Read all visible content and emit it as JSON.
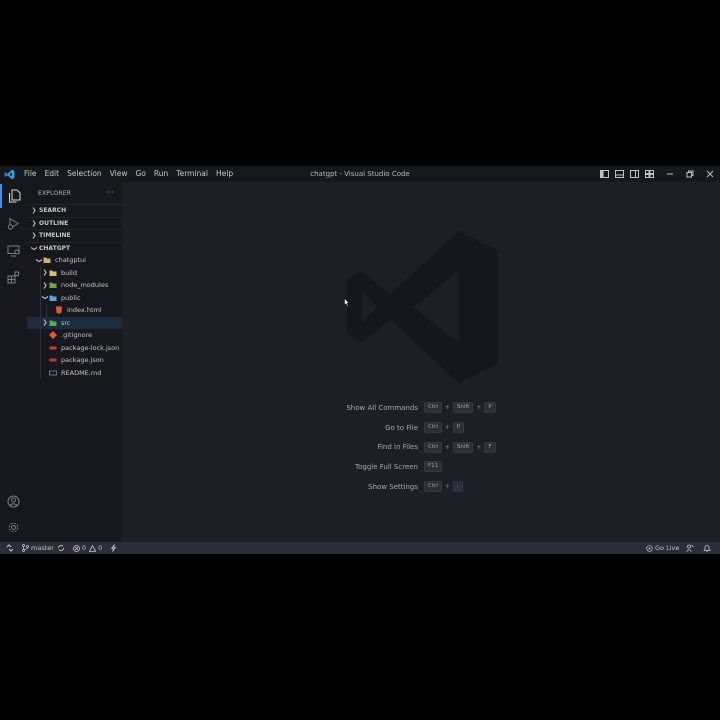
{
  "window": {
    "title": "chatgpt - Visual Studio Code",
    "accent": "#3794ff"
  },
  "menu": [
    "File",
    "Edit",
    "Selection",
    "View",
    "Go",
    "Run",
    "Terminal",
    "Help"
  ],
  "layout_controls": [
    "toggle-primary-sidebar-icon",
    "toggle-panel-icon",
    "toggle-secondary-sidebar-icon",
    "customize-layout-icon"
  ],
  "window_controls": [
    "minimize-icon",
    "restore-icon",
    "close-icon"
  ],
  "activity_bar": {
    "top": [
      "explorer-icon",
      "run-debug-icon",
      "remote-explorer-icon",
      "extensions-icon"
    ],
    "bottom": [
      "account-icon",
      "manage-gear-icon"
    ]
  },
  "sidebar": {
    "title": "EXPLORER",
    "more": "···",
    "sections": [
      "SEARCH",
      "OUTLINE",
      "TIMELINE"
    ],
    "workspace": "CHATGPT",
    "tree": [
      {
        "label": "chatgptui",
        "type": "folder",
        "expanded": true,
        "depth": 0
      },
      {
        "label": "build",
        "type": "folder",
        "expanded": false,
        "depth": 1
      },
      {
        "label": "node_modules",
        "type": "folder",
        "expanded": false,
        "depth": 1
      },
      {
        "label": "public",
        "type": "folder",
        "expanded": true,
        "depth": 1
      },
      {
        "label": "index.html",
        "type": "html",
        "depth": 2
      },
      {
        "label": "src",
        "type": "folder",
        "expanded": false,
        "depth": 1,
        "selected": true
      },
      {
        "label": ".gitignore",
        "type": "git",
        "depth": 1
      },
      {
        "label": "package-lock.json",
        "type": "json",
        "depth": 1
      },
      {
        "label": "package.json",
        "type": "json",
        "depth": 1
      },
      {
        "label": "README.md",
        "type": "md",
        "depth": 1
      }
    ]
  },
  "shortcuts": [
    {
      "label": "Show All Commands",
      "keys": [
        "Ctrl",
        "Shift",
        "P"
      ]
    },
    {
      "label": "Go to File",
      "keys": [
        "Ctrl",
        "P"
      ]
    },
    {
      "label": "Find in Files",
      "keys": [
        "Ctrl",
        "Shift",
        "F"
      ]
    },
    {
      "label": "Toggle Full Screen",
      "keys": [
        "F11"
      ]
    },
    {
      "label": "Show Settings",
      "keys": [
        "Ctrl",
        ","
      ]
    }
  ],
  "statusbar": {
    "branch": "master",
    "errors": "0",
    "warnings": "0",
    "go_live": "Go Live"
  }
}
